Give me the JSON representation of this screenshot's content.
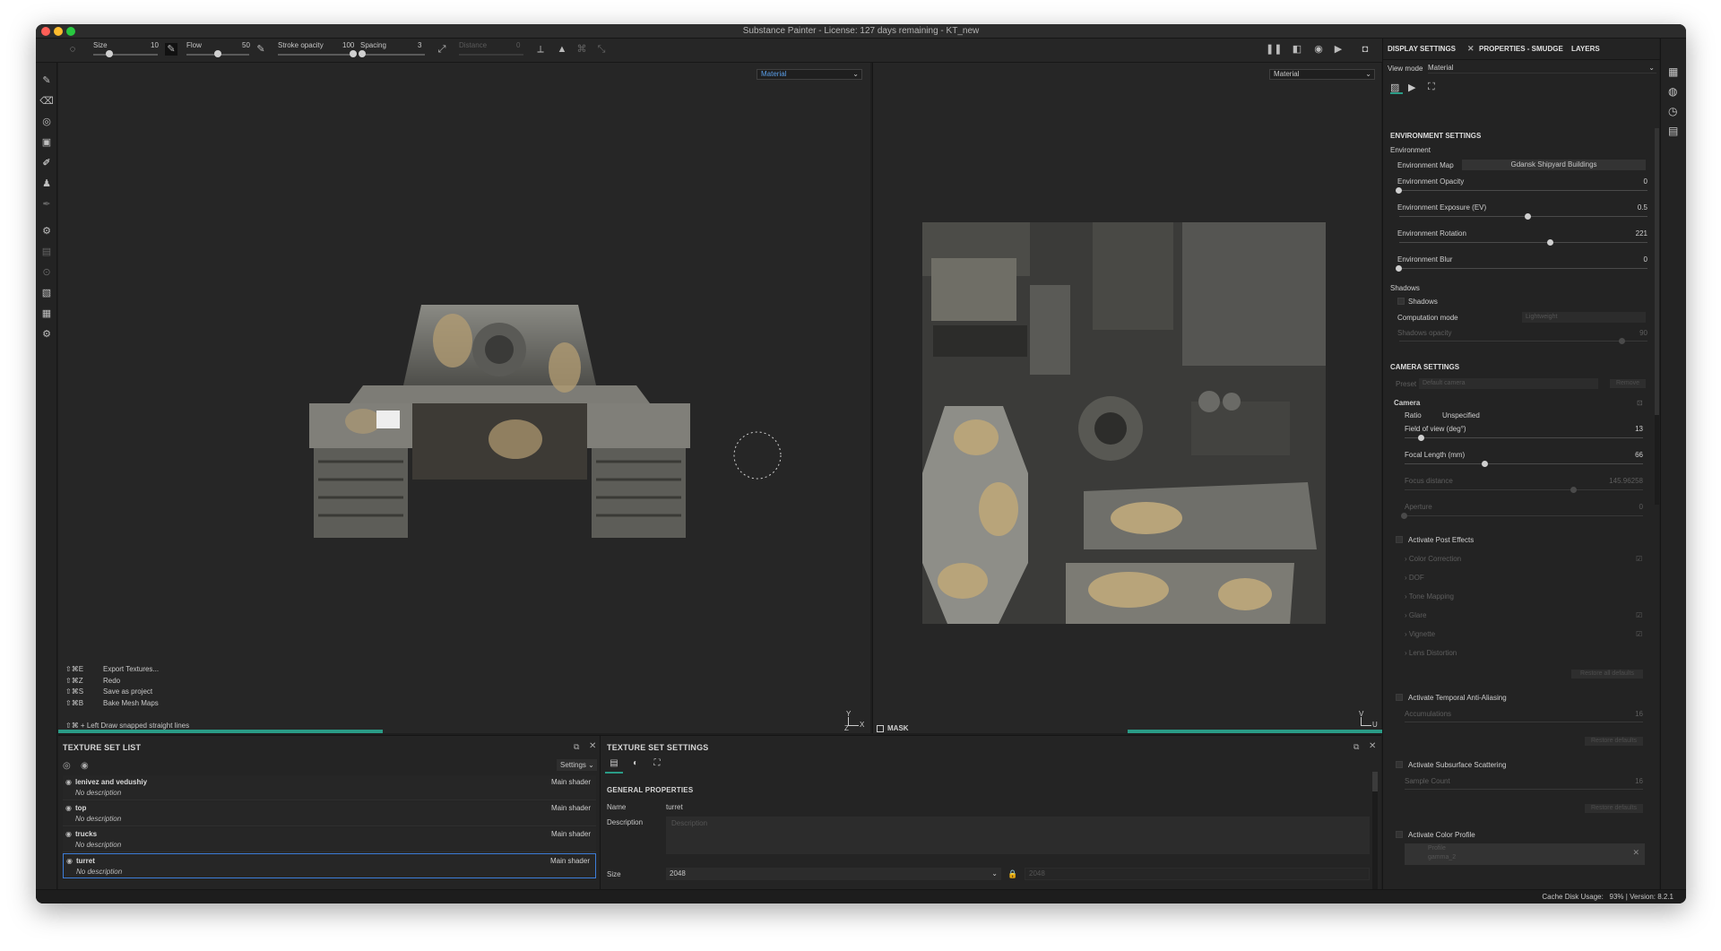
{
  "window": {
    "title": "Substance Painter - License: 127 days remaining - KT_new"
  },
  "toolbar": {
    "size_label": "Size",
    "size_value": "10",
    "size_level": 0.25,
    "flow_label": "Flow",
    "flow_value": "50",
    "flow_level": 0.5,
    "stroke_opacity_label": "Stroke opacity",
    "stroke_opacity_value": "100",
    "stroke_opacity_level": 1.0,
    "spacing_label": "Spacing",
    "spacing_value": "3",
    "spacing_level": 0.03,
    "distance_label": "Distance",
    "distance_value": "0"
  },
  "viewport3d": {
    "mode_select": "Material",
    "shortcuts": [
      {
        "keys": "⇧⌘E",
        "action": "Export Textures..."
      },
      {
        "keys": "⇧⌘Z",
        "action": "Redo"
      },
      {
        "keys": "⇧⌘S",
        "action": "Save as project"
      },
      {
        "keys": "⇧⌘B",
        "action": "Bake Mesh Maps"
      }
    ],
    "hint": "⇧⌘ + Left  Draw snapped straight lines",
    "axis_y": "Y",
    "axis_x": "X",
    "axis_z": "Z",
    "progress": 0.4
  },
  "viewport2d": {
    "mode_select": "Material",
    "mask_label": "MASK",
    "axis_v": "V",
    "axis_u": "U",
    "progress": 0.5
  },
  "texture_set_list": {
    "title": "TEXTURE SET LIST",
    "settings_label": "Settings",
    "items": [
      {
        "name": "lenivez and vedushiy",
        "desc": "No description",
        "shader": "Main shader",
        "selected": false
      },
      {
        "name": "top",
        "desc": "No description",
        "shader": "Main shader",
        "selected": false
      },
      {
        "name": "trucks",
        "desc": "No description",
        "shader": "Main shader",
        "selected": false
      },
      {
        "name": "turret",
        "desc": "No description",
        "shader": "Main shader",
        "selected": true
      }
    ]
  },
  "texture_set_settings": {
    "title": "TEXTURE SET SETTINGS",
    "general_properties": "GENERAL PROPERTIES",
    "name_label": "Name",
    "name_value": "turret",
    "description_label": "Description",
    "description_placeholder": "Description",
    "size_label": "Size",
    "size_value": "2048",
    "size_value2": "2048"
  },
  "right_panel": {
    "tabs": [
      "DISPLAY SETTINGS",
      "PROPERTIES - SMUDGE",
      "LAYERS"
    ],
    "view_mode_label": "View mode",
    "view_mode_value": "Material",
    "environment_settings": "ENVIRONMENT SETTINGS",
    "environment_label": "Environment",
    "environment_map_label": "Environment Map",
    "environment_map_value": "Gdansk Shipyard Buildings",
    "env_opacity_label": "Environment Opacity",
    "env_opacity_value": "0",
    "env_opacity_level": 0.0,
    "env_exposure_label": "Environment Exposure (EV)",
    "env_exposure_value": "0.5",
    "env_exposure_level": 0.52,
    "env_rotation_label": "Environment Rotation",
    "env_rotation_value": "221",
    "env_rotation_level": 0.61,
    "env_blur_label": "Environment Blur",
    "env_blur_value": "0",
    "env_blur_level": 0.0,
    "shadows_section": "Shadows",
    "shadows_checkbox": "Shadows",
    "computation_mode_label": "Computation mode",
    "computation_mode_value": "Lightweight",
    "shadows_opacity_label": "Shadows opacity",
    "shadows_opacity_value": "90",
    "shadows_opacity_level": 0.9,
    "camera_settings": "CAMERA SETTINGS",
    "preset_label": "Preset",
    "preset_value": "Default camera",
    "preset_button": "Remove",
    "camera_label": "Camera",
    "ratio_label": "Ratio",
    "ratio_value": "Unspecified",
    "fov_label": "Field of view (deg°)",
    "fov_value": "13",
    "fov_level": 0.07,
    "focal_label": "Focal Length (mm)",
    "focal_value": "66",
    "focal_level": 0.34,
    "focus_distance_label": "Focus distance",
    "focus_distance_value": "145.96258",
    "focus_distance_level": 0.71,
    "aperture_label": "Aperture",
    "aperture_value": "0",
    "aperture_level": 0.0,
    "post_effects_label": "Activate Post Effects",
    "post_effects": [
      "Color Correction",
      "DOF",
      "Tone Mapping",
      "Glare",
      "Vignette",
      "Lens Distortion"
    ],
    "restore_all_defaults": "Restore all defaults",
    "taa_label": "Activate Temporal Anti-Aliasing",
    "accumulations_label": "Accumulations",
    "accumulations_value": "16",
    "restore_defaults": "Restore defaults",
    "sss_label": "Activate Subsurface Scattering",
    "sample_count_label": "Sample Count",
    "sample_count_value": "16",
    "color_profile_label": "Activate Color Profile",
    "profile_placeholder": "Profile",
    "profile_sub": "gamma_2"
  },
  "status": {
    "cache": "Cache Disk Usage:",
    "cache_value": "93%",
    "version": "Version: 8.2.1"
  },
  "colors": {
    "accent": "#2a9b86",
    "selection": "#3d7dd8",
    "panel_bg": "#232323",
    "viewport_bg": "#262626"
  }
}
